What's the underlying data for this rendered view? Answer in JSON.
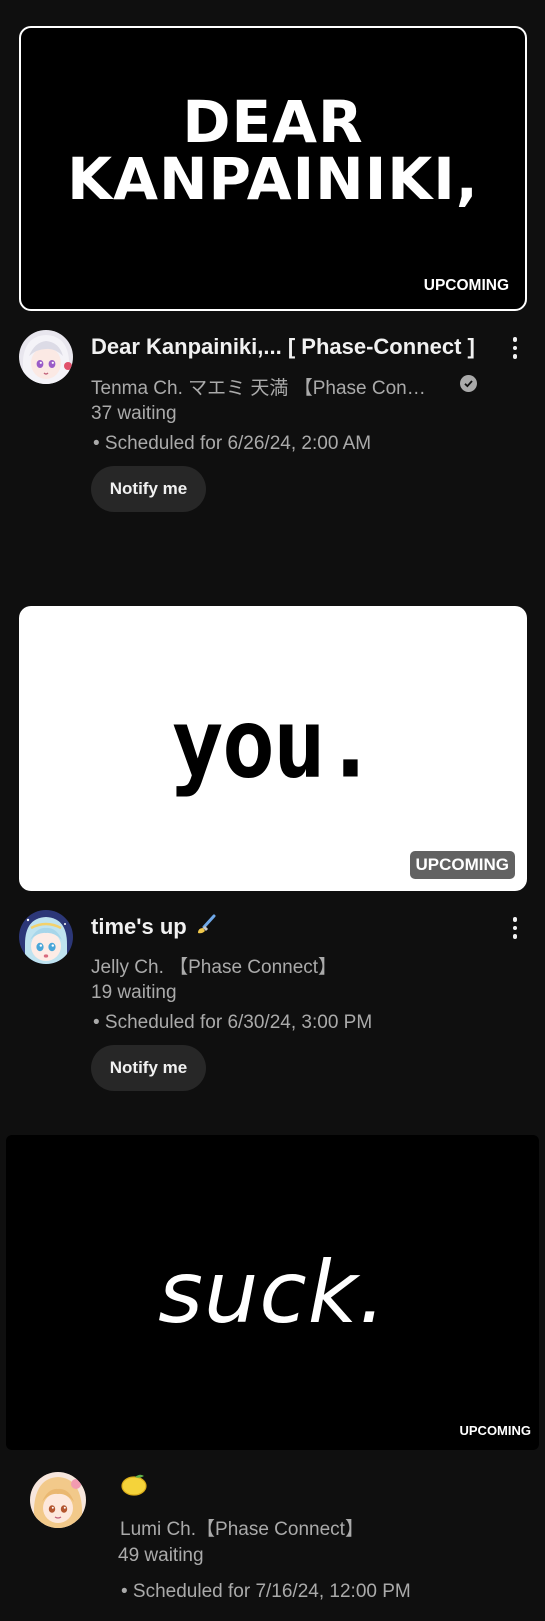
{
  "videos": [
    {
      "thumbnail_text_lines": [
        "DEAR",
        "KANPAINIKI,"
      ],
      "badge": "UPCOMING",
      "title": "Dear Kanpainiki,... [ Phase-Connect ]",
      "channel": "Tenma Ch. マエミ 天満 【Phase Con…",
      "verified": true,
      "waiting": "37 waiting",
      "scheduled": "• Scheduled for 6/26/24, 2:00 AM",
      "notify_label": "Notify me",
      "avatar_icon": "silver-hair-avatar"
    },
    {
      "thumbnail_text": "you.",
      "badge": "UPCOMING",
      "title": "time's up",
      "title_emoji": "🖌",
      "channel": "Jelly Ch. 【Phase Connect】",
      "waiting": "19 waiting",
      "scheduled": "• Scheduled for 6/30/24, 3:00 PM",
      "notify_label": "Notify me",
      "avatar_icon": "blue-hair-avatar"
    },
    {
      "thumbnail_text": "suck.",
      "badge": "UPCOMING",
      "title_emoji": "🍋",
      "channel": "Lumi Ch.【Phase Connect】",
      "waiting": "49 waiting",
      "scheduled": "• Scheduled for 7/16/24, 12:00 PM",
      "avatar_icon": "blonde-hair-avatar"
    }
  ],
  "colors": {
    "background": "#0f0f0f",
    "primary_text": "#f1f1f1",
    "secondary_text": "#aaaaaa",
    "button_bg": "#272727"
  }
}
